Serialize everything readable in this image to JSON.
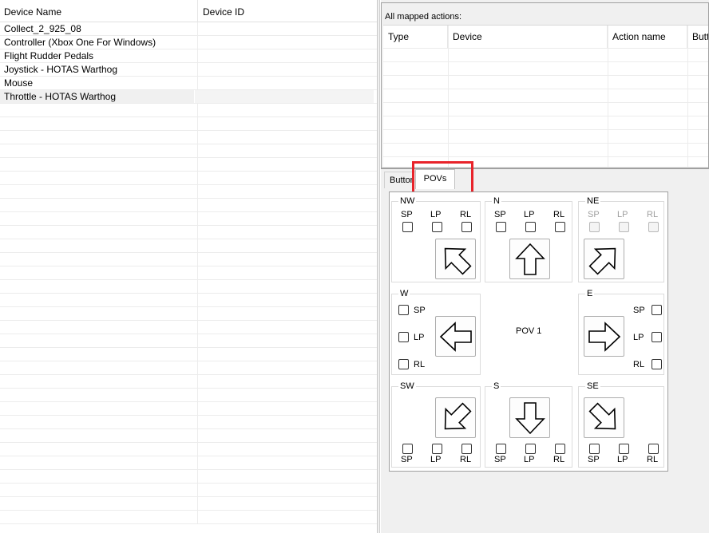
{
  "device_list": {
    "columns": [
      "Device Name",
      "Device ID"
    ],
    "devices": [
      {
        "name": "Collect_2_925_08",
        "id": ""
      },
      {
        "name": "Controller (Xbox One For Windows)",
        "id": ""
      },
      {
        "name": "Flight Rudder Pedals",
        "id": ""
      },
      {
        "name": "Joystick - HOTAS Warthog",
        "id": ""
      },
      {
        "name": "Mouse",
        "id": ""
      },
      {
        "name": "Throttle - HOTAS Warthog",
        "id": "",
        "selected": true
      }
    ]
  },
  "mapped_actions": {
    "label": "All mapped actions:",
    "columns": [
      "Type",
      "Device",
      "Action name",
      "Butto"
    ]
  },
  "tabs": [
    {
      "label": "Buttons",
      "active": false
    },
    {
      "label": "POVs",
      "active": true
    }
  ],
  "pov": {
    "center_label": "POV 1",
    "directions": {
      "nw": {
        "title": "NW",
        "options": [
          "SP",
          "LP",
          "RL"
        ],
        "enabled": true,
        "arrow": "arrow-up-left-icon"
      },
      "n": {
        "title": "N",
        "options": [
          "SP",
          "LP",
          "RL"
        ],
        "enabled": true,
        "arrow": "arrow-up-icon"
      },
      "ne": {
        "title": "NE",
        "options": [
          "SP",
          "LP",
          "RL"
        ],
        "enabled": false,
        "arrow": "arrow-up-right-icon"
      },
      "w": {
        "title": "W",
        "options": [
          "SP",
          "LP",
          "RL"
        ],
        "enabled": true,
        "arrow": "arrow-left-icon"
      },
      "e": {
        "title": "E",
        "options": [
          "SP",
          "LP",
          "RL"
        ],
        "enabled": true,
        "arrow": "arrow-right-icon"
      },
      "sw": {
        "title": "SW",
        "options": [
          "SP",
          "LP",
          "RL"
        ],
        "enabled": true,
        "arrow": "arrow-down-left-icon"
      },
      "s": {
        "title": "S",
        "options": [
          "SP",
          "LP",
          "RL"
        ],
        "enabled": true,
        "arrow": "arrow-down-icon"
      },
      "se": {
        "title": "SE",
        "options": [
          "SP",
          "LP",
          "RL"
        ],
        "enabled": true,
        "arrow": "arrow-down-right-icon"
      }
    }
  },
  "colors": {
    "highlight": "#e8232a"
  }
}
